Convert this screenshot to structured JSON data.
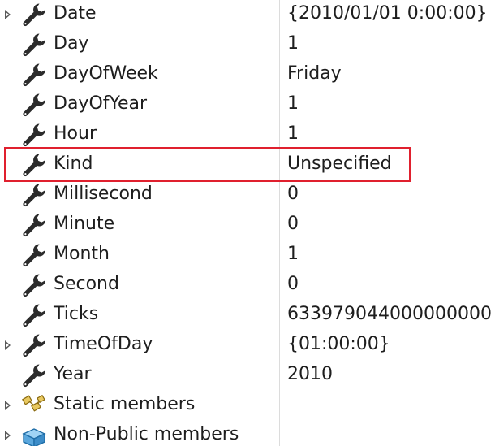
{
  "properties": [
    {
      "name": "Date",
      "value": "{2010/01/01 0:00:00}",
      "expandable": true,
      "icon": "wrench-icon"
    },
    {
      "name": "Day",
      "value": "1",
      "expandable": false,
      "icon": "wrench-icon"
    },
    {
      "name": "DayOfWeek",
      "value": "Friday",
      "expandable": false,
      "icon": "wrench-icon"
    },
    {
      "name": "DayOfYear",
      "value": "1",
      "expandable": false,
      "icon": "wrench-icon"
    },
    {
      "name": "Hour",
      "value": "1",
      "expandable": false,
      "icon": "wrench-icon"
    },
    {
      "name": "Kind",
      "value": "Unspecified",
      "expandable": false,
      "icon": "wrench-icon",
      "highlighted": true
    },
    {
      "name": "Millisecond",
      "value": "0",
      "expandable": false,
      "icon": "wrench-icon"
    },
    {
      "name": "Minute",
      "value": "0",
      "expandable": false,
      "icon": "wrench-icon"
    },
    {
      "name": "Month",
      "value": "1",
      "expandable": false,
      "icon": "wrench-icon"
    },
    {
      "name": "Second",
      "value": "0",
      "expandable": false,
      "icon": "wrench-icon"
    },
    {
      "name": "Ticks",
      "value": "633979044000000000",
      "expandable": false,
      "icon": "wrench-icon"
    },
    {
      "name": "TimeOfDay",
      "value": "{01:00:00}",
      "expandable": true,
      "icon": "wrench-icon"
    },
    {
      "name": "Year",
      "value": "2010",
      "expandable": false,
      "icon": "wrench-icon"
    }
  ],
  "groups": [
    {
      "name": "Static members",
      "expandable": true,
      "icon": "static-members-icon"
    },
    {
      "name": "Non-Public members",
      "expandable": true,
      "icon": "non-public-members-icon"
    }
  ],
  "colors": {
    "text": "#1e1e1e",
    "highlight_border": "#e0202e",
    "wrench": "#2b2b2b",
    "static_icon": "#c8a032",
    "nonpublic_icon": "#3c8cc8"
  }
}
